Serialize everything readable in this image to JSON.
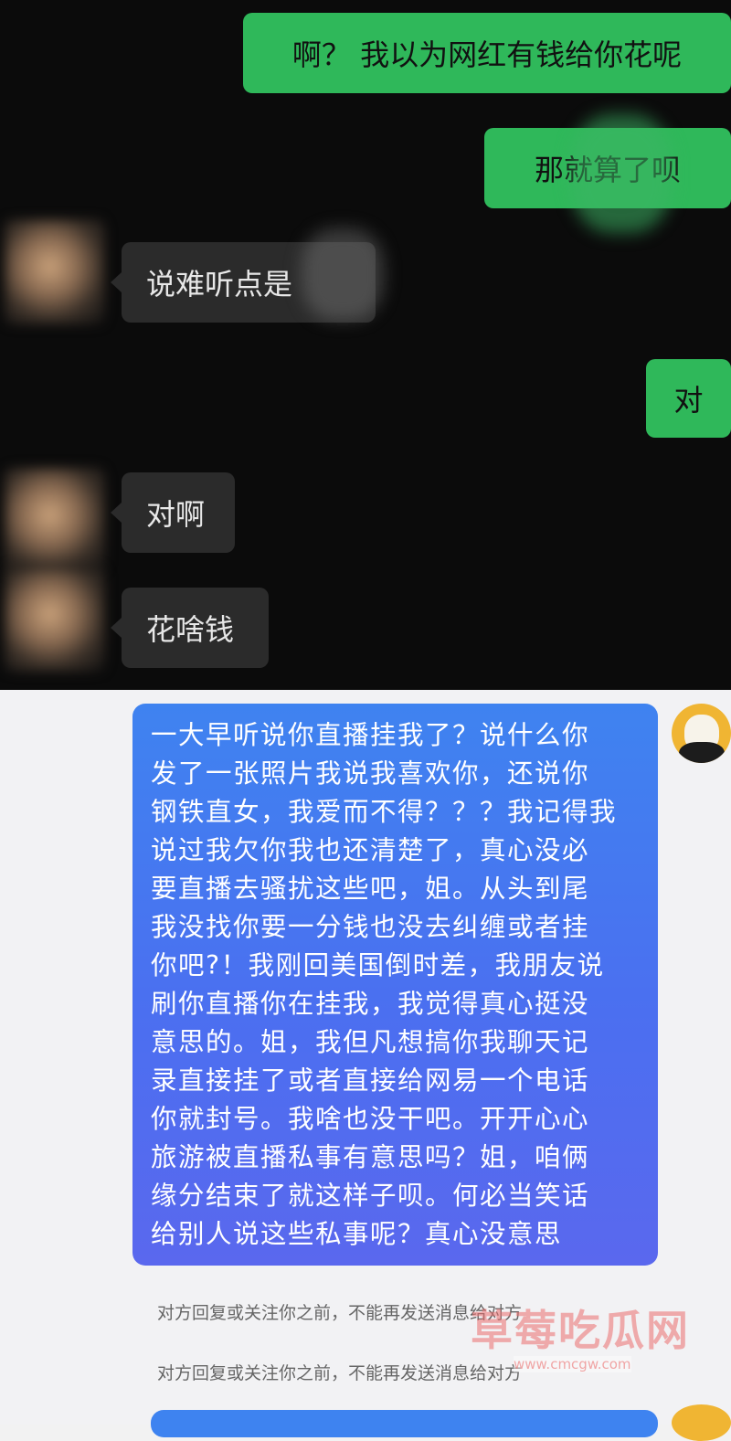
{
  "chat_dark": {
    "messages": [
      {
        "side": "sent",
        "text": "啊？ 我以为网红有钱给你花呢"
      },
      {
        "side": "sent",
        "text": "那就算了呗"
      },
      {
        "side": "received",
        "text": "说难听点是"
      },
      {
        "side": "sent",
        "text": "对"
      },
      {
        "side": "received",
        "text": "对啊"
      },
      {
        "side": "received",
        "text": "花啥钱"
      }
    ]
  },
  "chat_light": {
    "long_message_lines": [
      "一大早听说你直播挂我了？说什么你",
      "发了一张照片我说我喜欢你，还说你",
      "钢铁直女，我爱而不得？？？我记得我",
      "说过我欠你我也还清楚了，真心没必",
      "要直播去骚扰这些吧，姐。从头到尾",
      "我没找你要一分钱也没去纠缠或者挂",
      "你吧?！我刚回美国倒时差，我朋友说",
      "刷你直播你在挂我，我觉得真心挺没",
      "意思的。姐，我但凡想搞你我聊天记",
      "录直接挂了或者直接给网易一个电话",
      "你就封号。我啥也没干吧。开开心心",
      "旅游被直播私事有意思吗？姐，咱俩",
      "缘分结束了就这样子呗。何必当笑话",
      "给别人说这些私事呢？真心没意思"
    ],
    "notices": [
      "对方回复或关注你之前，不能再发送消息给对方",
      "对方回复或关注你之前，不能再发送消息给对方"
    ]
  },
  "watermark": {
    "text": "草莓吃瓜网",
    "url": "www.cmcgw.com"
  },
  "colors": {
    "sent_bubble": "#2fb85a",
    "received_bubble": "#2b2b2b",
    "dark_background": "#0b0b0b",
    "light_bubble": "#4b6ff0"
  }
}
